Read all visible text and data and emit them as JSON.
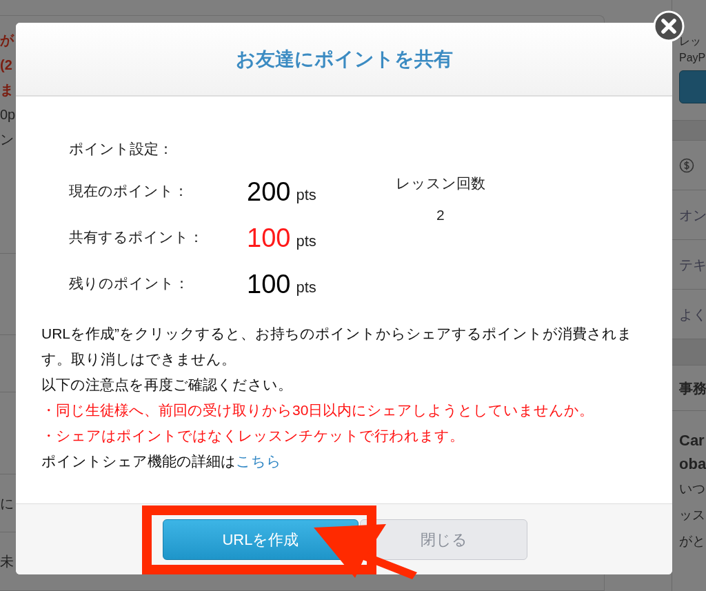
{
  "background": {
    "left_rows": [
      {
        "texts": [
          "が",
          "(2",
          "ま",
          "0p",
          "ン"
        ],
        "kind": "intro"
      },
      {
        "texts": [],
        "kind": "plain"
      },
      {
        "texts": [],
        "kind": "plain"
      },
      {
        "texts": [],
        "kind": "plain"
      },
      {
        "texts": [
          "に"
        ],
        "kind": "plain"
      },
      {
        "texts": [
          "未"
        ],
        "kind": "plain"
      }
    ],
    "right_panel": {
      "intro": [
        "レッ",
        "PayP"
      ],
      "menu": [
        "オン",
        "テキ",
        "よく"
      ],
      "section_title": "事務",
      "card_title": [
        "Car",
        "oba"
      ],
      "card_text": [
        "いつ",
        "ッス",
        "がと"
      ]
    }
  },
  "modal": {
    "title": "お友達にポイントを共有",
    "section_label": "ポイント設定：",
    "rows": [
      {
        "label": "現在のポイント：",
        "value": "200",
        "unit": "pts",
        "kind": "normal"
      },
      {
        "label": "共有するポイント：",
        "value": "100",
        "unit": "pts",
        "kind": "highlight"
      },
      {
        "label": "残りのポイント：",
        "value": "100",
        "unit": "pts",
        "kind": "normal"
      }
    ],
    "lesson_count": {
      "label": "レッスン回数",
      "value": "2"
    },
    "notes": [
      {
        "text": "URLを作成”をクリックすると、お持ちのポイントからシェアするポイントが消費されます。取り消しはできません。",
        "kind": "plain"
      },
      {
        "text": "以下の注意点を再度ご確認ください。",
        "kind": "plain"
      },
      {
        "text": "・同じ生徒様へ、前回の受け取りから30日以内にシェアしようとしていませんか。",
        "kind": "warning"
      },
      {
        "text": "・シェアはポイントではなくレッスンチケットで行われます。",
        "kind": "warning"
      }
    ],
    "detail": {
      "text": "ポイントシェア機能の詳細は",
      "link": "こちら"
    },
    "buttons": [
      {
        "label": "URLを作成",
        "kind": "primary"
      },
      {
        "label": "閉じる",
        "kind": "secondary"
      }
    ]
  }
}
